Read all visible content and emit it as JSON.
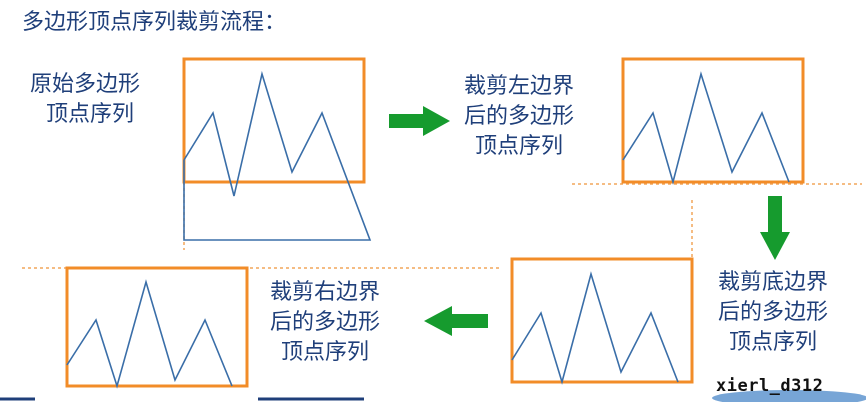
{
  "title": "多边形顶点序列裁剪流程：",
  "steps": {
    "original": [
      "原始多边形",
      "顶点序列"
    ],
    "clip_left": [
      "裁剪左边界",
      "后的多边形",
      "顶点序列"
    ],
    "clip_bottom": [
      "裁剪底边界",
      "后的多边形",
      "顶点序列"
    ],
    "clip_right": [
      "裁剪右边界",
      "后的多边形",
      "顶点序列"
    ]
  },
  "watermark": "xierl_d312",
  "colors": {
    "text": "#1f3f7a",
    "clip_window": "#f28c28",
    "polygon": "#3a6ea8",
    "arrow": "#169b2e",
    "dashed_edge": "#f2a55a"
  }
}
